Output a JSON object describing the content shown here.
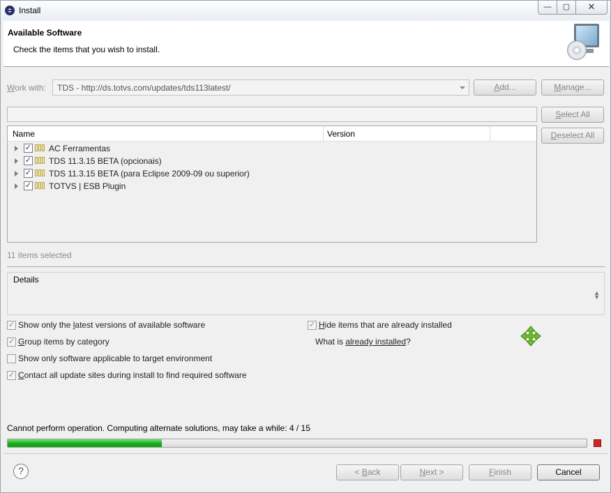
{
  "window": {
    "title": "Install",
    "controls": {
      "minimize": "—",
      "maximize": "▢",
      "close": "✕"
    }
  },
  "banner": {
    "heading": "Available Software",
    "subtitle": "Check the items that you wish to install."
  },
  "work_with": {
    "label_prefix": "W",
    "label_rest": "ork with:",
    "value": "TDS - http://ds.totvs.com/updates/tds113latest/",
    "add_label": "Add...",
    "add_mnemonic": "A",
    "add_rest": "dd...",
    "manage_label": "Manage...",
    "manage_mnemonic": "M",
    "manage_rest": "anage..."
  },
  "filter": {
    "value": ""
  },
  "buttons": {
    "select_all_mnemonic": "S",
    "select_all_rest": "elect All",
    "deselect_all_mnemonic": "D",
    "deselect_all_rest": "eselect All"
  },
  "table": {
    "columns": {
      "name": "Name",
      "version": "Version"
    },
    "rows": [
      {
        "label": "AC Ferramentas",
        "checked": "✓"
      },
      {
        "label": "TDS 11.3.15 BETA (opcionais)",
        "checked": "✓"
      },
      {
        "label": "TDS 11.3.15 BETA (para Eclipse 2009-09 ou superior)",
        "checked": "✓"
      },
      {
        "label": "TOTVS | ESB Plugin",
        "checked": "✓"
      }
    ]
  },
  "selection_count": "11 items selected",
  "details": {
    "label": "Details"
  },
  "options": {
    "latest_pre": "Show only the ",
    "latest_mn": "l",
    "latest_post": "atest versions of available software",
    "group_mn": "G",
    "group_post": "roup items by category",
    "applicable": "Show only software applicable to target environment",
    "contact_mn": "C",
    "contact_post": "ontact all update sites during install to find required software",
    "hide_mn": "H",
    "hide_post": "ide items that are already installed",
    "whatis_pre": "What is ",
    "whatis_link": "already installed",
    "whatis_post": "?",
    "check_mark": "✓"
  },
  "status": {
    "message": "Cannot perform operation. Computing alternate solutions, may take a while: 4 / 15",
    "progress_fraction": 0.2667
  },
  "footer": {
    "help": "?",
    "back_pre": "< ",
    "back_mn": "B",
    "back_post": "ack",
    "next_mn": "N",
    "next_post": "ext >",
    "finish_mn": "F",
    "finish_post": "inish",
    "cancel": "Cancel"
  },
  "colors": {
    "progress_green": "#19b319",
    "stop_red": "#d62424",
    "move_icon_green": "#6cc02a"
  }
}
